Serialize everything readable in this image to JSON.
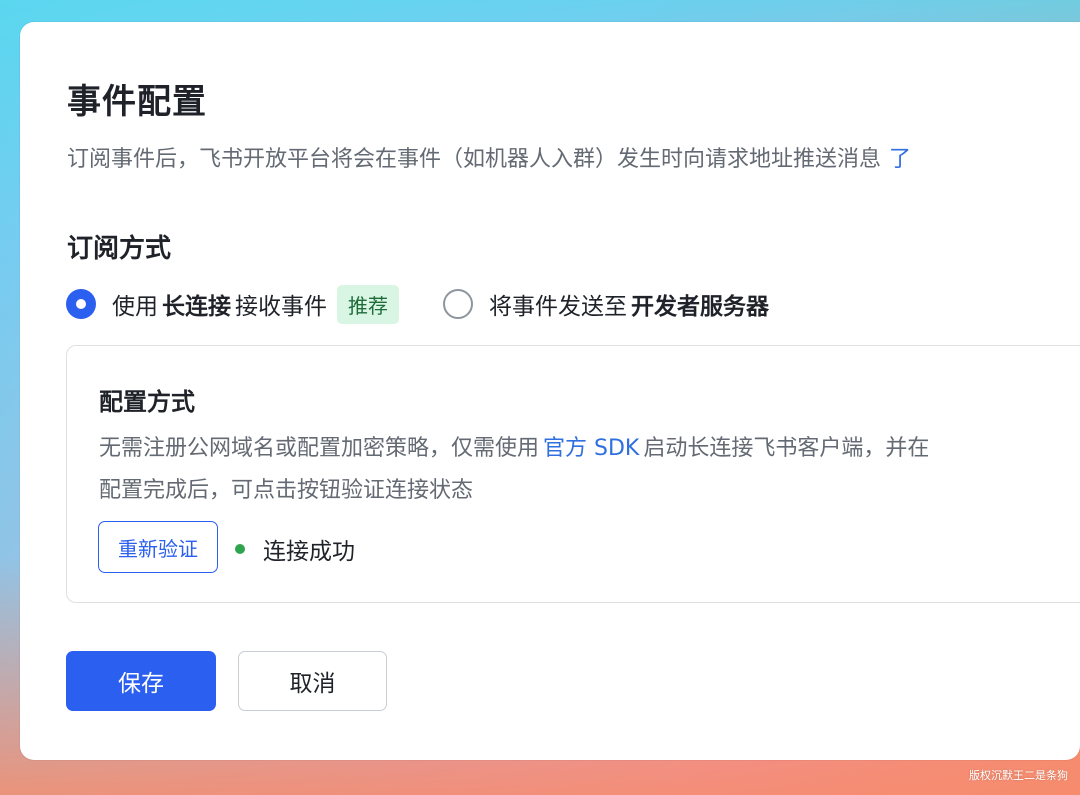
{
  "header": {
    "title": "事件配置",
    "description": "订阅事件后，飞书开放平台将会在事件（如机器人入群）发生时向请求地址推送消息",
    "description_link": "了"
  },
  "subscription": {
    "section_title": "订阅方式",
    "options": [
      {
        "prefix": "使用",
        "bold": "长连接",
        "suffix": "接收事件",
        "badge": "推荐",
        "checked": true
      },
      {
        "prefix": "将事件发送至",
        "bold": "开发者服务器",
        "checked": false
      }
    ]
  },
  "config_panel": {
    "title": "配置方式",
    "line1_before": "无需注册公网域名或配置加密策略，仅需使用",
    "line1_link": "官方 SDK",
    "line1_after": "启动长连接飞书客户端，并在",
    "line2": "配置完成后，可点击按钮验证连接状态",
    "verify_button": "重新验证",
    "status_text": "连接成功"
  },
  "actions": {
    "save": "保存",
    "cancel": "取消"
  },
  "watermark": "版权沉默王二是条狗",
  "colors": {
    "primary": "#2b5ff0",
    "link": "#2f6fe0",
    "success": "#2ea44f",
    "badge_bg": "#d9f5e3"
  }
}
